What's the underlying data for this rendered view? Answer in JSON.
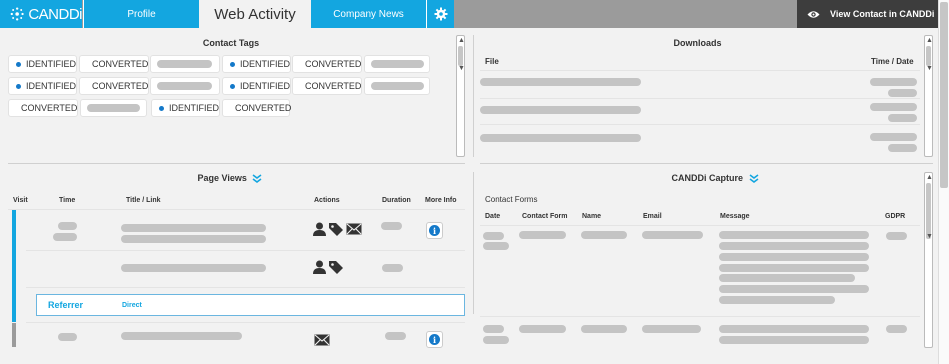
{
  "header": {
    "logo_text": "CANDDi",
    "tabs": [
      {
        "label": "Profile"
      },
      {
        "label": "Web Activity"
      },
      {
        "label": "Company News"
      }
    ],
    "view_contact_label": "View Contact in CANDDi",
    "accent_color": "#13a6e0"
  },
  "contact_tags": {
    "title": "Contact Tags",
    "tags": [
      {
        "label": "IDENTIFIED",
        "color": "#1479c9"
      },
      {
        "label": "CONVERTED",
        "color": "#2ecc71"
      },
      {
        "label": "",
        "color": ""
      },
      {
        "label": "IDENTIFIED",
        "color": "#1479c9"
      },
      {
        "label": "CONVERTED",
        "color": "#2ecc71"
      },
      {
        "label": "",
        "color": ""
      },
      {
        "label": "IDENTIFIED",
        "color": "#1479c9"
      },
      {
        "label": "CONVERTED",
        "color": "#2ecc71"
      },
      {
        "label": "",
        "color": ""
      },
      {
        "label": "IDENTIFIED",
        "color": "#1479c9"
      },
      {
        "label": "CONVERTED",
        "color": "#2ecc71"
      },
      {
        "label": "",
        "color": ""
      },
      {
        "label": "CONVERTED",
        "color": "#2ecc71"
      },
      {
        "label": "",
        "color": ""
      },
      {
        "label": "IDENTIFIED",
        "color": "#1479c9"
      },
      {
        "label": "CONVERTED",
        "color": "#2ecc71"
      }
    ]
  },
  "downloads": {
    "title": "Downloads",
    "col_file": "File",
    "col_time": "Time / Date"
  },
  "page_views": {
    "title": "Page Views",
    "columns": {
      "visit": "Visit",
      "time": "Time",
      "title_link": "Title / Link",
      "actions": "Actions",
      "duration": "Duration",
      "more_info": "More Info"
    },
    "referrer_label": "Referrer",
    "referrer_value": "Direct"
  },
  "capture": {
    "title": "CANDDi Capture",
    "subtitle": "Contact Forms",
    "columns": {
      "date": "Date",
      "contact_form": "Contact Form",
      "name": "Name",
      "email": "Email",
      "message": "Message",
      "gdpr": "GDPR"
    }
  }
}
